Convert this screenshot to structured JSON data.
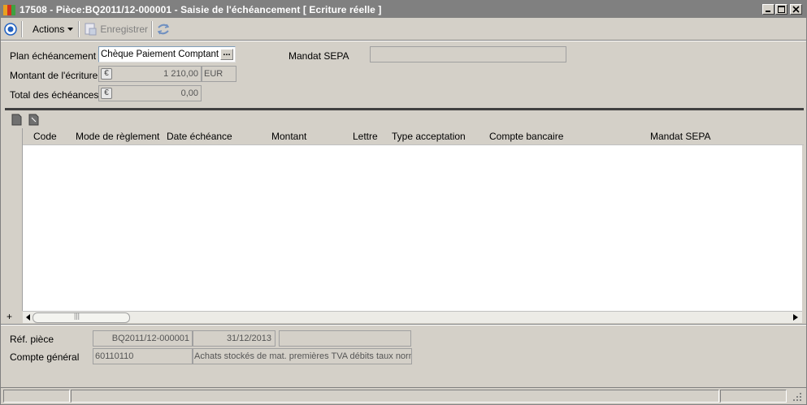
{
  "window": {
    "title": "17508 - Pièce:BQ2011/12-000001 -  Saisie de l'échéancement [ Ecriture réelle ]",
    "icon": "app-color-bars-icon"
  },
  "toolbar": {
    "actions_label": "Actions",
    "save_label": "Enregistrer"
  },
  "form": {
    "plan_label": "Plan échéancement",
    "plan_value": "Chèque Paiement Comptant",
    "mandat_label": "Mandat SEPA",
    "mandat_value": "",
    "montant_label": "Montant de l'écriture",
    "montant_value": "1 210,00",
    "currency": "EUR",
    "total_label": "Total des échéances",
    "total_value": "0,00"
  },
  "grid": {
    "columns": [
      "Code",
      "Mode de règlement",
      "Date échéance",
      "Montant",
      "Lettre",
      "Type acceptation",
      "Compte bancaire",
      "Mandat SEPA"
    ],
    "rows": []
  },
  "footer": {
    "ref_label": "Réf. pièce",
    "ref_value": "BQ2011/12-000001",
    "ref_date": "31/12/2013",
    "ref_extra": "",
    "compte_label": "Compte général",
    "compte_value": "60110110",
    "compte_desc": "Achats stockés de mat. premières TVA débits taux norm"
  },
  "colors": {
    "titlebar": "#808080",
    "window_bg": "#d4d0c8",
    "grid_bg": "#ffffff"
  }
}
